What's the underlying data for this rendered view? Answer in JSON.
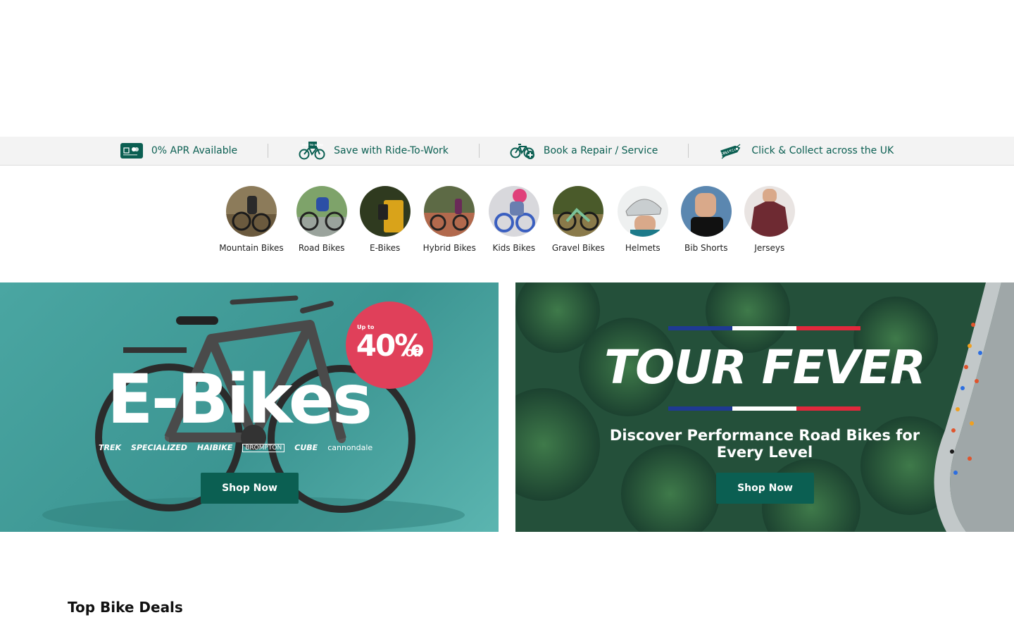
{
  "usp": [
    {
      "icon": "credit-card-icon",
      "label": "0% APR Available"
    },
    {
      "icon": "ride-to-work-bike-icon",
      "label": "Save with Ride-To-Work"
    },
    {
      "icon": "bike-repair-icon",
      "label": "Book a Repair / Service"
    },
    {
      "icon": "collect-tag-icon",
      "label": "Click & Collect across the UK"
    }
  ],
  "ride_to_work_tag": "RIDE TO WORK",
  "collect_tag": "COLLECT",
  "categories": [
    {
      "label": "Mountain Bikes",
      "color": "#6b5a3e"
    },
    {
      "label": "Road Bikes",
      "color": "#4d6a3a"
    },
    {
      "label": "E-Bikes",
      "color": "#2f3a1f"
    },
    {
      "label": "Hybrid Bikes",
      "color": "#8a5a46"
    },
    {
      "label": "Kids Bikes",
      "color": "#6a7fb0"
    },
    {
      "label": "Gravel Bikes",
      "color": "#5a6a3a"
    },
    {
      "label": "Helmets",
      "color": "#c9ced0"
    },
    {
      "label": "Bib Shorts",
      "color": "#5b87b0"
    },
    {
      "label": "Jerseys",
      "color": "#6e2a32"
    }
  ],
  "banners": {
    "ebikes": {
      "title": "E-Bikes",
      "badge_upto": "Up to",
      "badge_pct": "40%",
      "badge_off": "Off",
      "brands": [
        "TREK",
        "SPECIALIZED",
        "HAIBIKE",
        "BROMPTON",
        "CUBE",
        "cannondale"
      ],
      "button": "Shop Now"
    },
    "tour": {
      "title": "TOUR FEVER",
      "subtitle": "Discover Performance Road Bikes for Every Level",
      "button": "Shop Now"
    }
  },
  "section_title": "Top Bike Deals",
  "colors": {
    "brand_green": "#0b5f52",
    "usp_bg": "#f3f3f3",
    "sale_pink": "#e0405a",
    "flag_blue": "#1f3a93",
    "flag_white": "#ffffff",
    "flag_red": "#e2283c"
  }
}
